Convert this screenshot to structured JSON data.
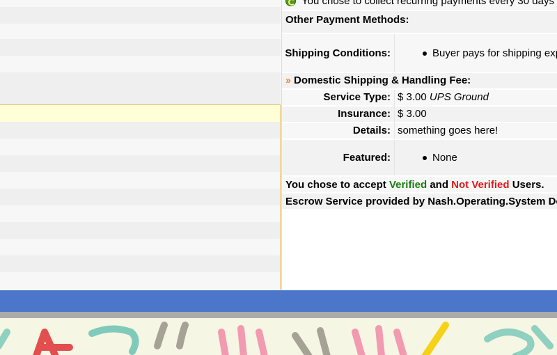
{
  "summary": {
    "recurring_text": "You chose to collect recurring payments every 30 days",
    "other_payment_label": "Other Payment Methods:",
    "shipping_conditions_label": "Shipping Conditions:",
    "shipping_conditions_value": "Buyer pays for shipping exp",
    "domestic_heading": "Domestic Shipping & Handling Fee:",
    "service_type_label": "Service Type:",
    "service_type_amount": "$ 3.00",
    "service_type_carrier": "UPS Ground",
    "insurance_label": "Insurance:",
    "insurance_value": "$ 3.00",
    "details_label": "Details:",
    "details_value": "something goes here!",
    "featured_label": "Featured:",
    "featured_value": "None",
    "accept_prefix": "You chose to accept",
    "accept_verified": "Verified",
    "accept_and": "and",
    "accept_not_verified": "Not Verified",
    "accept_suffix": "Users.",
    "escrow_text": "Escrow Service provided by Nash.Operating.System De"
  },
  "icons": {
    "recurring": "recurring-payment-icon",
    "section_marker": "double-chevron-icon"
  },
  "colors": {
    "verified": "#1a7d12",
    "not_verified": "#e01b1b",
    "nav_bar": "#4b76c9",
    "highlight_row": "#ffffd7",
    "section_marker": "#f08a1c"
  }
}
